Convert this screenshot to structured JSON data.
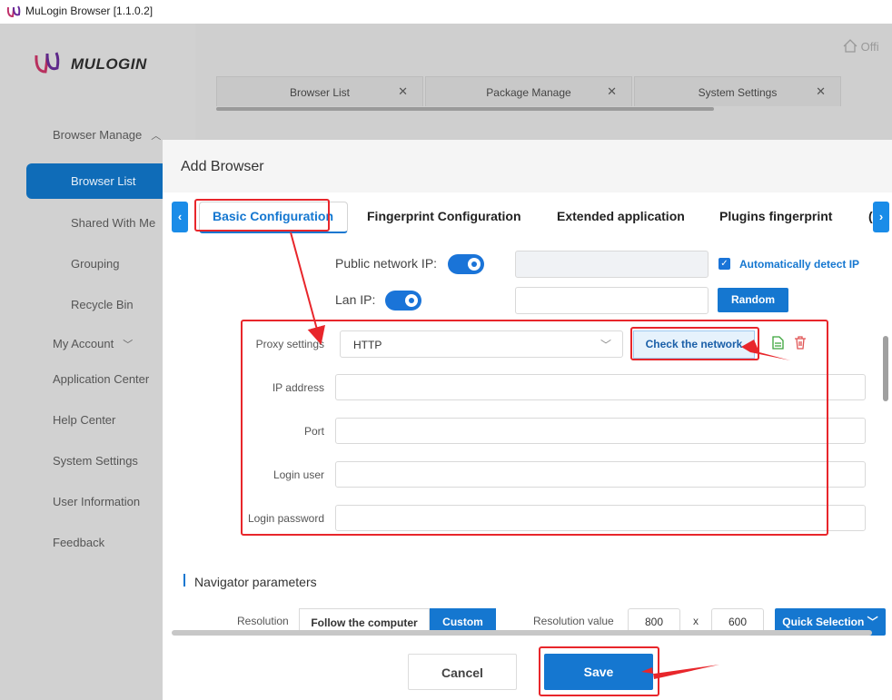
{
  "app": {
    "title": "MuLogin Browser  [1.1.0.2]",
    "brand": "MULOGIN",
    "home_link": "Offi"
  },
  "sidebar": {
    "browser_manage": "Browser Manage",
    "items": [
      "Browser List",
      "Shared With Me",
      "Grouping",
      "Recycle Bin"
    ],
    "my_account": "My Account",
    "links": [
      "Application Center",
      "Help Center",
      "System Settings",
      "User Information",
      "Feedback"
    ]
  },
  "tabs": [
    "Browser List",
    "Package Manage",
    "System Settings"
  ],
  "modal": {
    "title": "Add Browser",
    "config_tabs": [
      "Basic Configuration",
      "Fingerprint Configuration",
      "Extended application",
      "Plugins fingerprint",
      "("
    ],
    "public_ip_label": "Public network IP:",
    "lan_ip_label": "Lan IP:",
    "auto_detect": "Automatically detect IP",
    "random_label": "Random",
    "proxy": {
      "label": "Proxy settings",
      "value": "HTTP",
      "check_network": "Check the network",
      "ip_label": "IP address",
      "port_label": "Port",
      "user_label": "Login user",
      "password_label": "Login password"
    },
    "navigator": {
      "title": "Navigator parameters",
      "resolution_label": "Resolution",
      "follow_computer": "Follow the computer",
      "custom": "Custom",
      "resolution_value_label": "Resolution value",
      "width": "800",
      "x": "x",
      "height": "600",
      "quick_selection": "Quick Selection"
    },
    "cancel": "Cancel",
    "save": "Save"
  },
  "colors": {
    "accent": "#1577d0",
    "annotation": "#e8262b",
    "sidebar_active": "#0f6cb8"
  }
}
